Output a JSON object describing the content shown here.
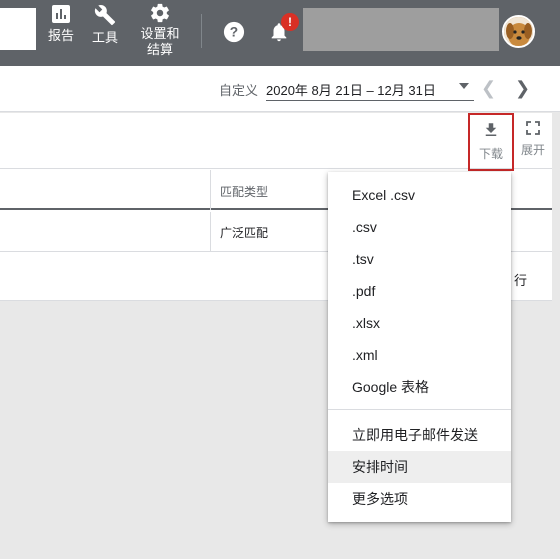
{
  "topbar": {
    "reports_label": "报告",
    "tools_label": "工具",
    "settings_label_line1": "设置和",
    "settings_label_line2": "结算",
    "notification_badge": "!"
  },
  "datebar": {
    "custom_label": "自定义",
    "date_range": "2020年 8月 21日 – 12月 31日"
  },
  "toolbar": {
    "download_label": "下载",
    "expand_label": "展开"
  },
  "table": {
    "header_match_type": "匹配类型",
    "row_match_type": "广泛匹配",
    "row_tail": "行"
  },
  "download_menu": {
    "formats": [
      "Excel .csv",
      ".csv",
      ".tsv",
      ".pdf",
      ".xlsx",
      ".xml",
      "Google 表格"
    ],
    "actions": [
      "立即用电子邮件发送",
      "安排时间",
      "更多选项"
    ],
    "highlighted_action": "安排时间"
  },
  "colors": {
    "topbar": "#5f6368",
    "highlight_border": "#c62828",
    "badge": "#d93025"
  }
}
